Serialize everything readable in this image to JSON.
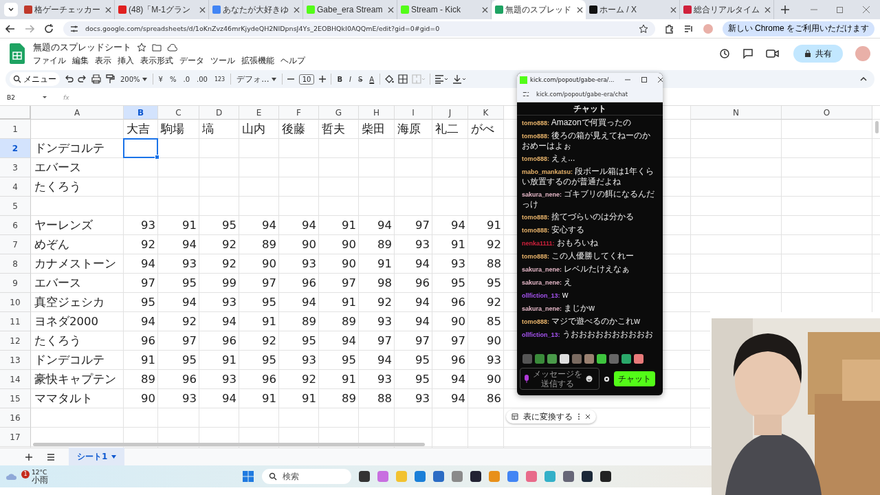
{
  "browser_tabs": [
    {
      "title": "格ゲーチェッカー",
      "selected": false
    },
    {
      "title": "(48)「M-1グラン",
      "selected": false
    },
    {
      "title": "あなたが大好きゆ",
      "selected": false
    },
    {
      "title": "Gabe_era Stream",
      "selected": false
    },
    {
      "title": "Stream - Kick",
      "selected": false
    },
    {
      "title": "無題のスプレッド",
      "selected": true
    },
    {
      "title": "ホーム / X",
      "selected": false
    },
    {
      "title": "総合リアルタイム",
      "selected": false
    }
  ],
  "address_bar": {
    "url": "docs.google.com/spreadsheets/d/1oKnZvz46mrKjydeQH2NIDpnsJ4Ys_2EOBHQkI0AQQmE/edit?gid=0#gid=0",
    "update_notice": "新しい Chrome をご利用いただけます"
  },
  "document": {
    "title": "無題のスプレッドシート",
    "menu": [
      "ファイル",
      "編集",
      "表示",
      "挿入",
      "表示形式",
      "データ",
      "ツール",
      "拡張機能",
      "ヘルプ"
    ],
    "share_button": "共有"
  },
  "toolbar": {
    "menu_search": "メニュー",
    "zoom": "200%",
    "currency": "¥",
    "percent": "%",
    "decrease_decimal": ".0",
    "increase_decimal": ".00",
    "number_format": "123",
    "font": "デフォ...",
    "font_size": "10",
    "bold": "B",
    "italic": "I",
    "strikethrough": "S",
    "text_color": "A"
  },
  "formula_bar": {
    "cell_ref": "B2",
    "fx": "fx"
  },
  "grid": {
    "columns": [
      {
        "label": "A",
        "selected": false
      },
      {
        "label": "B",
        "selected": true
      },
      {
        "label": "C",
        "selected": false
      },
      {
        "label": "D",
        "selected": false
      },
      {
        "label": "E",
        "selected": false
      },
      {
        "label": "F",
        "selected": false
      },
      {
        "label": "G",
        "selected": false
      },
      {
        "label": "H",
        "selected": false
      },
      {
        "label": "I",
        "selected": false
      },
      {
        "label": "J",
        "selected": false
      },
      {
        "label": "K",
        "selected": false
      },
      {
        "label": "N",
        "selected": false
      },
      {
        "label": "O",
        "selected": false
      }
    ],
    "rows": [
      {
        "number": "1",
        "cells": [
          "",
          "大吉",
          "駒場",
          "塙",
          "山内",
          "後藤",
          "哲夫",
          "柴田",
          "海原",
          "礼二",
          "がべ"
        ],
        "selected": false
      },
      {
        "number": "2",
        "cells": [
          "ドンデコルテ",
          "",
          "",
          "",
          "",
          "",
          "",
          "",
          "",
          "",
          ""
        ],
        "selected": true
      },
      {
        "number": "3",
        "cells": [
          "エバース",
          "",
          "",
          "",
          "",
          "",
          "",
          "",
          "",
          "",
          ""
        ],
        "selected": false
      },
      {
        "number": "4",
        "cells": [
          "たくろう",
          "",
          "",
          "",
          "",
          "",
          "",
          "",
          "",
          "",
          ""
        ],
        "selected": false
      },
      {
        "number": "5",
        "cells": [
          "",
          "",
          "",
          "",
          "",
          "",
          "",
          "",
          "",
          "",
          ""
        ],
        "selected": false
      },
      {
        "number": "6",
        "cells": [
          "ヤーレンズ",
          "93",
          "91",
          "95",
          "94",
          "94",
          "91",
          "94",
          "97",
          "94",
          "91"
        ],
        "selected": false
      },
      {
        "number": "7",
        "cells": [
          "めぞん",
          "92",
          "94",
          "92",
          "89",
          "90",
          "90",
          "89",
          "93",
          "91",
          "92"
        ],
        "selected": false
      },
      {
        "number": "8",
        "cells": [
          "カナメストーン",
          "94",
          "93",
          "92",
          "90",
          "93",
          "90",
          "91",
          "94",
          "93",
          "88"
        ],
        "selected": false
      },
      {
        "number": "9",
        "cells": [
          "エバース",
          "97",
          "95",
          "99",
          "97",
          "96",
          "97",
          "98",
          "96",
          "95",
          "95"
        ],
        "selected": false
      },
      {
        "number": "10",
        "cells": [
          "真空ジェシカ",
          "95",
          "94",
          "93",
          "95",
          "94",
          "91",
          "92",
          "94",
          "96",
          "92"
        ],
        "selected": false
      },
      {
        "number": "11",
        "cells": [
          "ヨネダ2000",
          "94",
          "92",
          "94",
          "91",
          "89",
          "89",
          "93",
          "94",
          "90",
          "85"
        ],
        "selected": false
      },
      {
        "number": "12",
        "cells": [
          "たくろう",
          "96",
          "97",
          "96",
          "92",
          "95",
          "94",
          "97",
          "97",
          "97",
          "90"
        ],
        "selected": false
      },
      {
        "number": "13",
        "cells": [
          "ドンデコルテ",
          "91",
          "95",
          "91",
          "95",
          "93",
          "95",
          "94",
          "95",
          "96",
          "93"
        ],
        "selected": false
      },
      {
        "number": "14",
        "cells": [
          "豪快キャプテン",
          "89",
          "96",
          "93",
          "96",
          "92",
          "91",
          "93",
          "95",
          "94",
          "90"
        ],
        "selected": false
      },
      {
        "number": "15",
        "cells": [
          "ママタルト",
          "90",
          "93",
          "94",
          "91",
          "91",
          "89",
          "88",
          "93",
          "94",
          "86"
        ],
        "selected": false
      },
      {
        "number": "16",
        "cells": [
          "",
          "",
          "",
          "",
          "",
          "",
          "",
          "",
          "",
          "",
          ""
        ],
        "selected": false
      },
      {
        "number": "17",
        "cells": [
          "",
          "",
          "",
          "",
          "",
          "",
          "",
          "",
          "",
          "",
          ""
        ],
        "selected": false
      }
    ]
  },
  "convert_chip": "表に変換する",
  "sheet_tabs": [
    {
      "label": "シート1",
      "selected": true
    }
  ],
  "chat_popup": {
    "title": "kick.com/popout/gabe-era/...",
    "url": "kick.com/popout/gabe-era/chat",
    "header": "チャット",
    "messages": [
      {
        "user": "tomo888:",
        "text": "Amazonで何買ったの",
        "color": "#e8b36a"
      },
      {
        "user": "tomo888:",
        "text": "後ろの箱が見えてねーのかおめーはよぉ",
        "color": "#e8b36a"
      },
      {
        "user": "tomo888:",
        "text": "えぇ...",
        "color": "#e8b36a"
      },
      {
        "user": "mabo_mankatsu:",
        "text": "段ボール箱は1年くらい放置するのが普通だよね",
        "color": "#e8b36a"
      },
      {
        "user": "sakura_nene:",
        "text": "ゴキブリの餌になるんだっけ",
        "color": "#e6b8c8"
      },
      {
        "user": "tomo888:",
        "text": "捨てづらいのは分かる",
        "color": "#e8b36a"
      },
      {
        "user": "tomo888:",
        "text": "安心する",
        "color": "#e8b36a"
      },
      {
        "user": "nenka1111:",
        "text": "おもろいね",
        "color": "#d0213c"
      },
      {
        "user": "tomo888:",
        "text": "この人優勝してくれー",
        "color": "#e8b36a"
      },
      {
        "user": "sakura_nene:",
        "text": "レベルたけえなぁ",
        "color": "#e6b8c8"
      },
      {
        "user": "sakura_nene:",
        "text": "え",
        "color": "#e6b8c8"
      },
      {
        "user": "ollfiction_13:",
        "text": "w",
        "color": "#a552f0"
      },
      {
        "user": "sakura_nene:",
        "text": "まじかw",
        "color": "#e6b8c8"
      },
      {
        "user": "tomo888:",
        "text": "マジで遊べるのかこれw",
        "color": "#e8b36a"
      },
      {
        "user": "ollfiction_13:",
        "text": "うおおおおおおおおおお",
        "color": "#a552f0"
      }
    ],
    "input_placeholder": "メッセージを送信する",
    "send_button": "チャット"
  },
  "taskbar": {
    "temperature": "12°C",
    "weather": "小雨",
    "weather_badge": "1",
    "search_placeholder": "検索"
  }
}
